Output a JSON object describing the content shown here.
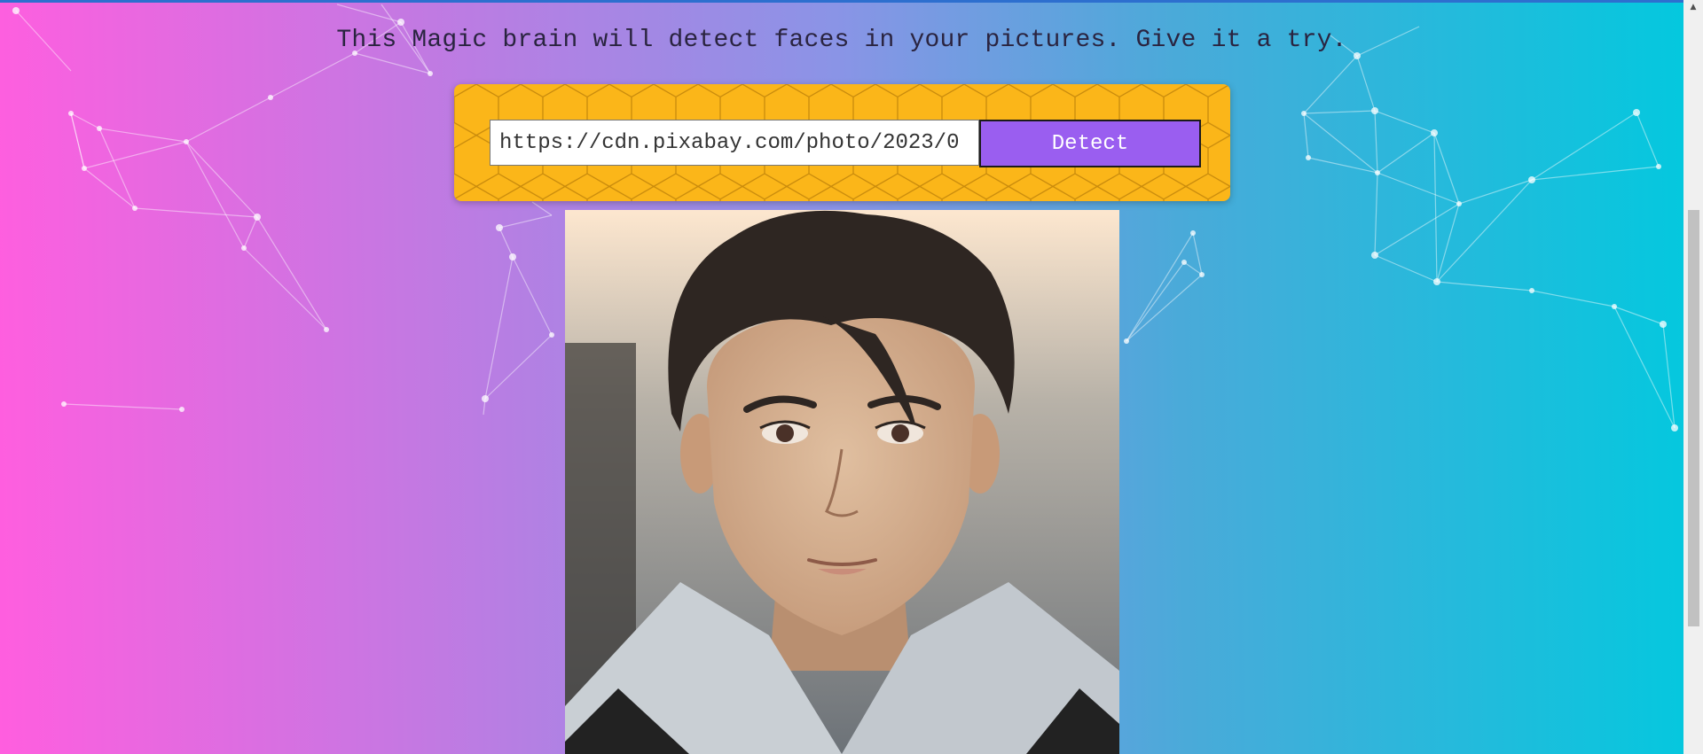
{
  "tagline": "This Magic brain will detect faces in your pictures. Give it a try.",
  "form": {
    "input_value": "https://cdn.pixabay.com/photo/2023/0",
    "detect_label": "Detect"
  },
  "colors": {
    "gradient_left": "#ff5edf",
    "gradient_right": "#04c8de",
    "form_background": "#fbb619",
    "button_background": "#9a5ef0"
  },
  "icons": {
    "scroll_up": "▲"
  }
}
